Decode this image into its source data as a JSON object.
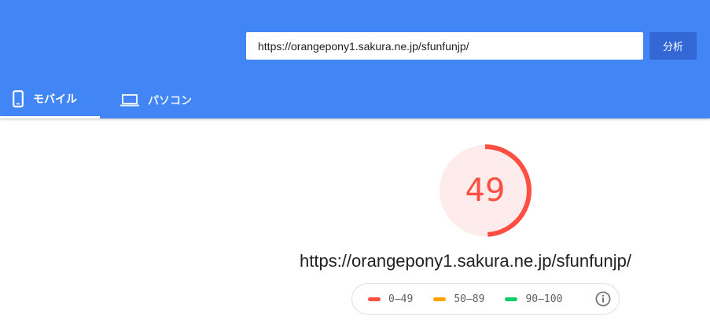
{
  "search": {
    "url_value": "https://orangepony1.sakura.ne.jp/sfunfunjp/",
    "analyze_label": "分析"
  },
  "tabs": [
    {
      "label": "モバイル",
      "icon": "smartphone-icon",
      "active": true
    },
    {
      "label": "パソコン",
      "icon": "laptop-icon",
      "active": false
    }
  ],
  "score": {
    "value": "49",
    "fraction": 0.49,
    "color": "#ff4e42",
    "track_color": "#fdeceb"
  },
  "page_url": "https://orangepony1.sakura.ne.jp/sfunfunjp/",
  "legend": [
    {
      "label": "0–49",
      "color": "#ff4e42"
    },
    {
      "label": "50–89",
      "color": "#ffa400"
    },
    {
      "label": "90–100",
      "color": "#0cce6b"
    }
  ],
  "colors": {
    "header": "#4285f4",
    "button": "#3367d6"
  }
}
